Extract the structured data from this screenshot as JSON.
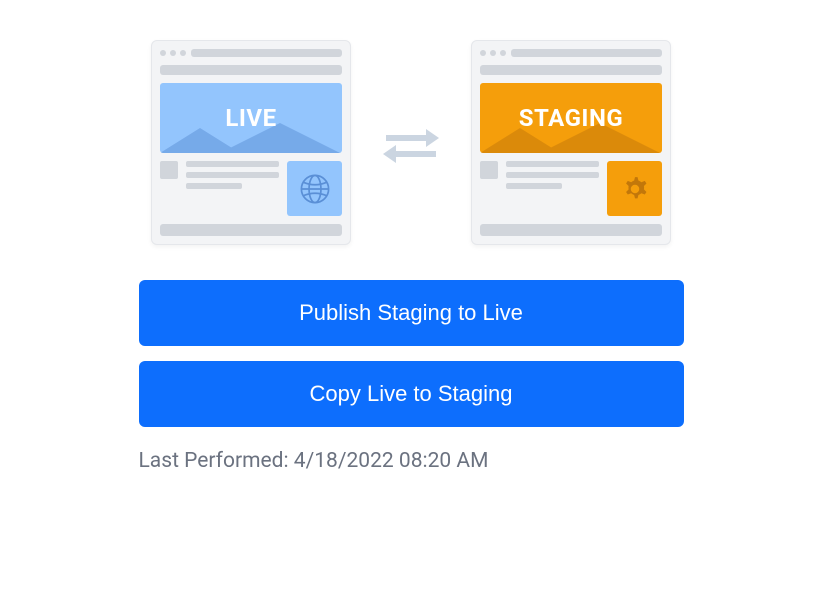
{
  "illustration": {
    "live": {
      "label": "LIVE"
    },
    "staging": {
      "label": "STAGING"
    }
  },
  "actions": {
    "publish_label": "Publish Staging to Live",
    "copy_label": "Copy Live to Staging"
  },
  "status": {
    "last_performed_prefix": "Last Performed: ",
    "last_performed_value": "4/18/2022 08:20 AM"
  }
}
